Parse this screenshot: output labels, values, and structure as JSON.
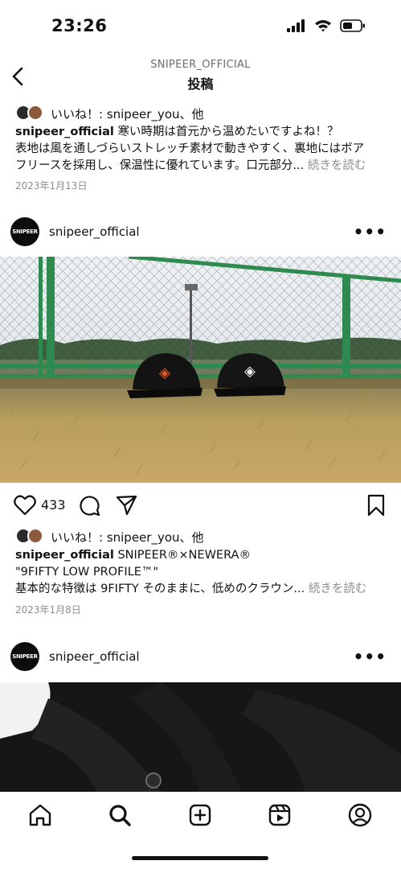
{
  "status_bar": {
    "time": "23:26"
  },
  "header": {
    "account": "SNIPEER_OFFICIAL",
    "title": "投稿"
  },
  "post1_tail": {
    "likes_text": "いいね！: snipeer_you、他",
    "caption_user": "snipeer_official",
    "caption_line1": "寒い時期は首元から温めたいですよね！？",
    "caption_line2": "表地は風を通しづらいストレッチ素材で動きやすく、裏地にはボア",
    "caption_line3": "フリースを採用し、保温性に優れています。口元部分...",
    "more": "続きを読む",
    "date": "2023年1月13日"
  },
  "post2": {
    "username": "snipeer_official",
    "avatar_text": "SNIPEER",
    "like_count": "433",
    "likes_text": "いいね！: snipeer_you、他",
    "caption_user": "snipeer_official",
    "caption_line1": "SNIPEER®×NEWERA®",
    "caption_line2": "\"9FIFTY LOW PROFILE™\"",
    "caption_line3": "基本的な特徴は 9FIFTY そのままに、低めのクラウン...",
    "more": "続きを読む",
    "date": "2023年1月8日"
  },
  "post3": {
    "username": "snipeer_official",
    "avatar_text": "SNIPEER"
  },
  "colors": {
    "text": "#111111",
    "muted": "#8e8e8e",
    "fence": "#2f8a4f",
    "grass": "#b8a060"
  }
}
